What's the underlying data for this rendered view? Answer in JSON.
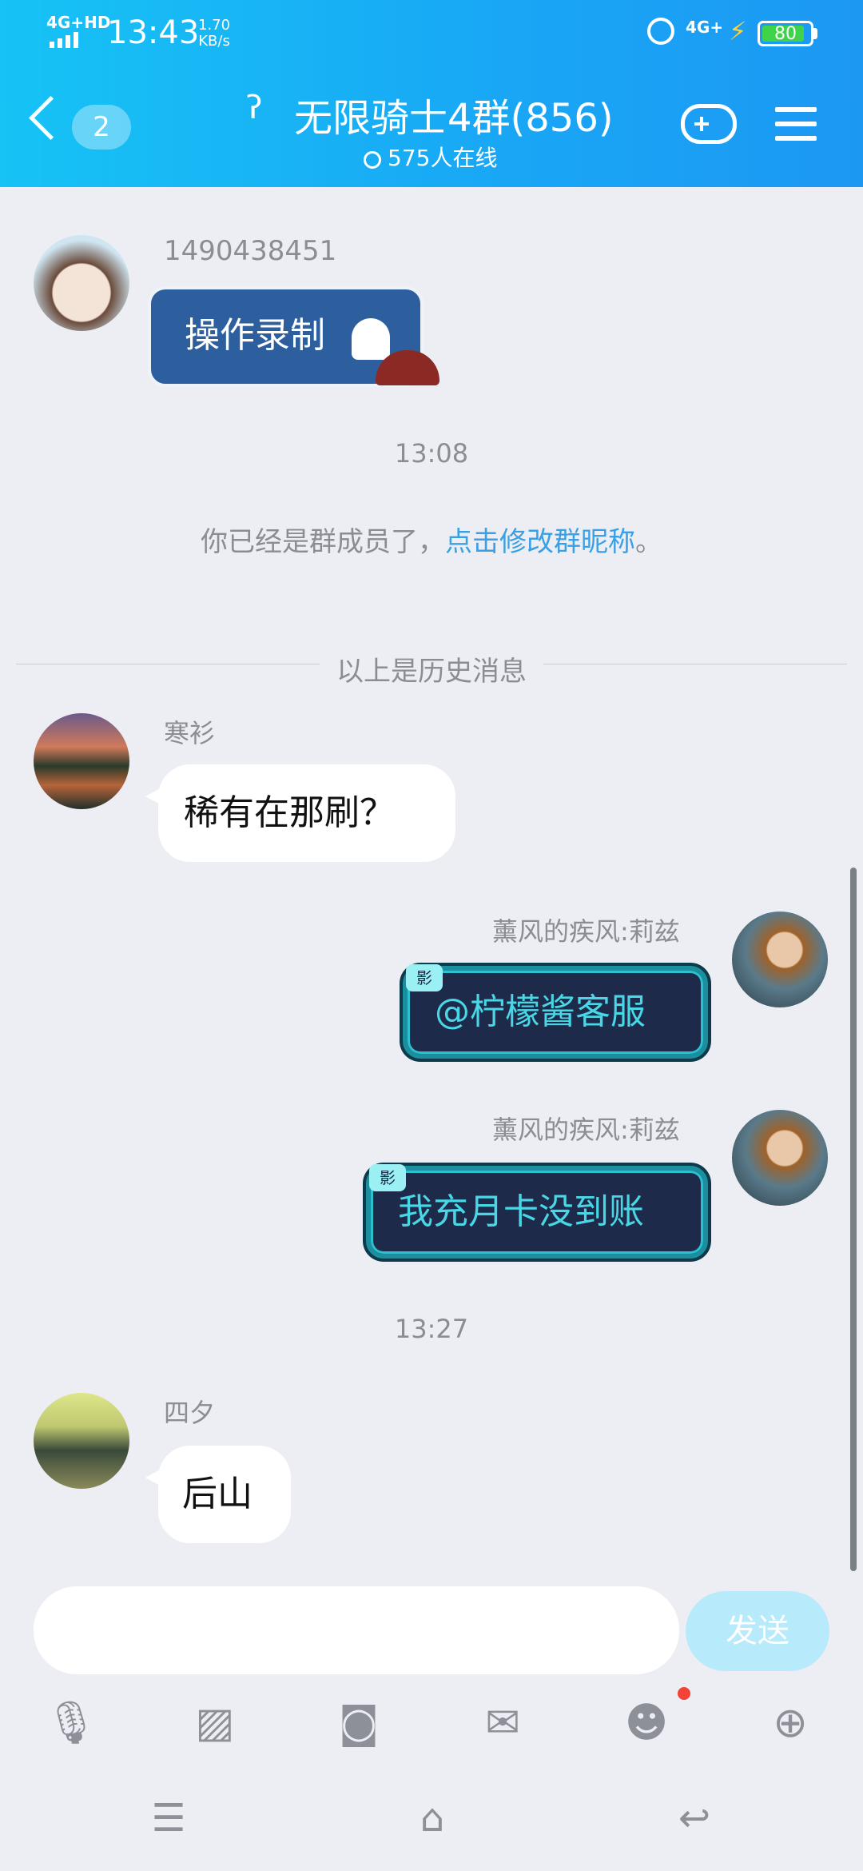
{
  "status_bar": {
    "network": "4G+HD",
    "time": "13:43",
    "speed_value": "1.70",
    "speed_unit": "KB/s",
    "network2": "4G+",
    "battery": "80"
  },
  "header": {
    "unread_count": "2",
    "title": "无限骑士4群(856)",
    "online": "575人在线"
  },
  "messages": {
    "m1": {
      "sender": "1490438451",
      "text": "操作录制"
    },
    "ts1": "13:08",
    "system": {
      "prefix": "你已经是群成员了，",
      "link": "点击修改群昵称",
      "suffix": "。"
    },
    "history_divider": "以上是历史消息",
    "m2": {
      "sender": "寒衫",
      "text": "稀有在那刷？"
    },
    "m3": {
      "sender": "薰风的疾风:莉兹",
      "badge": "影",
      "text": "@柠檬酱客服"
    },
    "m4": {
      "sender": "薰风的疾风:莉兹",
      "badge": "影",
      "text": "我充月卡没到账"
    },
    "ts2": "13:27",
    "m5": {
      "sender": "四夕",
      "text": "后山"
    }
  },
  "input": {
    "placeholder": "",
    "send_label": "发送"
  },
  "colors": {
    "header_start": "#16c3f5",
    "header_end": "#1c98f3",
    "link": "#3aa0e6",
    "send_disabled": "#b7eafa"
  }
}
